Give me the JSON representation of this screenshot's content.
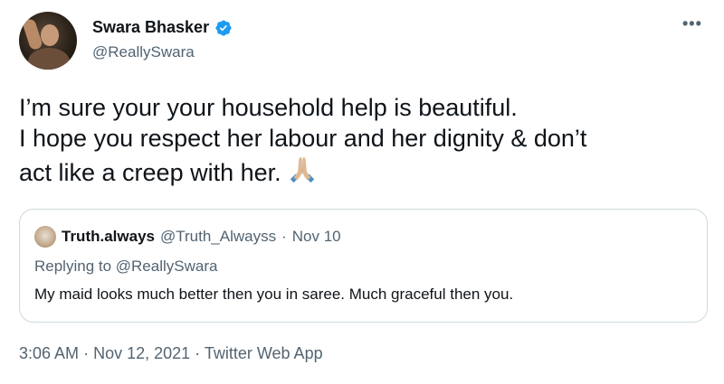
{
  "author": {
    "display_name": "Swara Bhasker",
    "handle": "@ReallySwara",
    "verified_icon": "verified-badge-icon",
    "more_label": "•••"
  },
  "tweet": {
    "lines": [
      "I’m sure your your household help is beautiful.",
      "I hope you respect her labour and her dignity & don’t",
      "act like a creep with her."
    ],
    "emoji": "folded-hands-icon"
  },
  "quoted": {
    "display_name": "Truth.always",
    "handle": "@Truth_Alwayss",
    "separator": "·",
    "date": "Nov 10",
    "replying_to": "Replying to @ReallySwara",
    "text": "My maid looks much better then you in saree. Much graceful then you."
  },
  "meta": {
    "time": "3:06 AM",
    "separator": "·",
    "date": "Nov 12, 2021",
    "source": "Twitter Web App"
  },
  "colors": {
    "verified_blue": "#1d9bf0",
    "secondary_text": "#536471",
    "border": "#cfd9de"
  }
}
